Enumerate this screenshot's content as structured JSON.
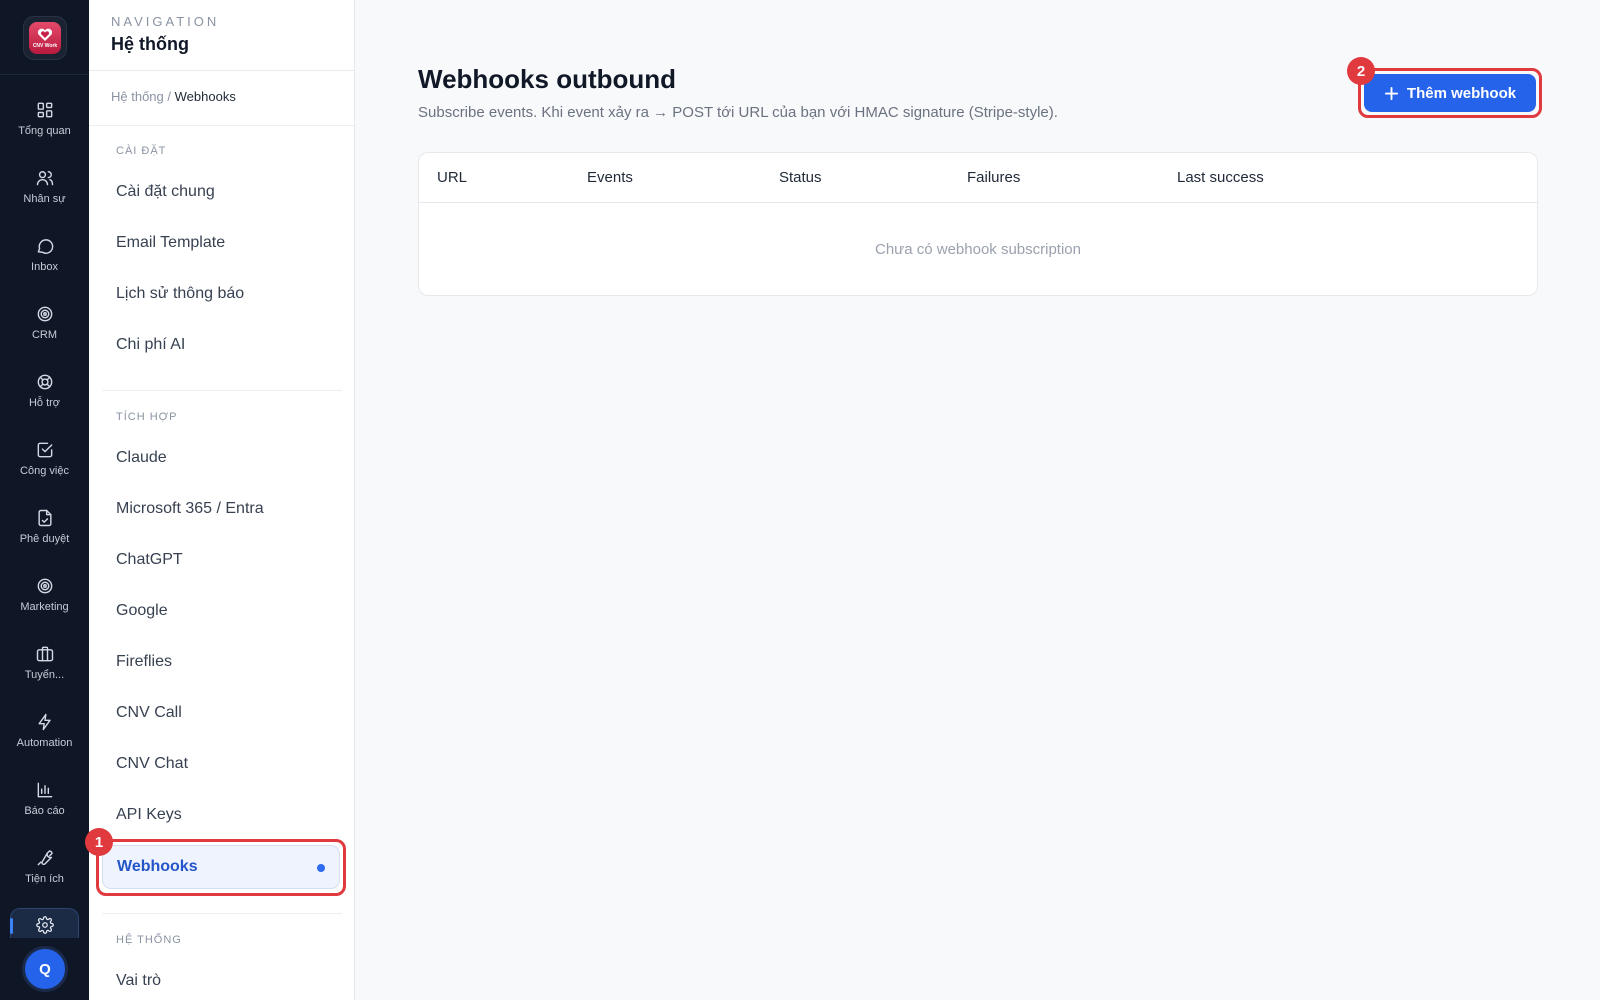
{
  "rail": {
    "logo_text": "CNV Work",
    "items": [
      {
        "label": "Tổng quan",
        "icon": "grid-icon"
      },
      {
        "label": "Nhân sự",
        "icon": "users-icon"
      },
      {
        "label": "Inbox",
        "icon": "chat-icon"
      },
      {
        "label": "CRM",
        "icon": "target-icon"
      },
      {
        "label": "Hỗ trợ",
        "icon": "lifebuoy-icon"
      },
      {
        "label": "Công việc",
        "icon": "checkbox-icon"
      },
      {
        "label": "Phê duyệt",
        "icon": "file-sign-icon"
      },
      {
        "label": "Marketing",
        "icon": "target-icon"
      },
      {
        "label": "Tuyển...",
        "icon": "briefcase-icon"
      },
      {
        "label": "Automation",
        "icon": "bolt-icon"
      },
      {
        "label": "Báo cáo",
        "icon": "bar-chart-icon"
      },
      {
        "label": "Tiện ích",
        "icon": "wrench-icon"
      }
    ],
    "active_icon": "gear-icon",
    "avatar_initial": "Q"
  },
  "sidebar": {
    "kicker": "NAVIGATION",
    "title": "Hệ thống",
    "breadcrumb": {
      "parent": "Hệ thống",
      "separator": "/",
      "current": "Webhooks"
    },
    "groups": [
      {
        "label": "CÀI ĐẶT",
        "items": [
          "Cài đặt chung",
          "Email Template",
          "Lịch sử thông báo",
          "Chi phí AI"
        ]
      },
      {
        "label": "TÍCH HỢP",
        "items": [
          "Claude",
          "Microsoft 365 / Entra",
          "ChatGPT",
          "Google",
          "Fireflies",
          "CNV Call",
          "CNV Chat",
          "API Keys"
        ]
      },
      {
        "label": "HỆ THỐNG",
        "items": [
          "Vai trò"
        ]
      }
    ],
    "active_item": "Webhooks"
  },
  "annotations": {
    "badge_1": "1",
    "badge_2": "2"
  },
  "main": {
    "title": "Webhooks outbound",
    "subtitle": "Subscribe events. Khi event xảy ra → POST tới URL của bạn với HMAC signature (Stripe-style).",
    "add_button": "Thêm webhook",
    "table": {
      "columns": [
        "URL",
        "Events",
        "Status",
        "Failures",
        "Last success"
      ],
      "empty_text": "Chưa có webhook subscription"
    }
  },
  "colors": {
    "accent": "#2563eb",
    "highlight": "#e0393e",
    "rail_bg": "#0f1726"
  }
}
